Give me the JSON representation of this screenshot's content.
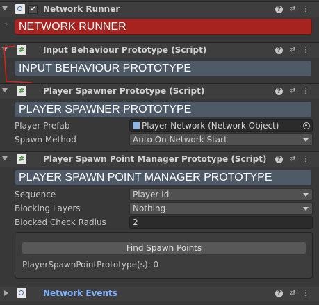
{
  "network_runner": {
    "title": "Network Runner",
    "enabled_check": "✔",
    "banner": "NETWORK RUNNER"
  },
  "input_behaviour": {
    "title": "Input Behaviour Prototype (Script)",
    "banner": "INPUT BEHAVIOUR PROTOTYPE"
  },
  "player_spawner": {
    "title": "Player Spawner Prototype (Script)",
    "banner": "PLAYER SPAWNER PROTOTYPE",
    "player_prefab_label": "Player Prefab",
    "player_prefab_value": "Player Network (Network Object)",
    "spawn_method_label": "Spawn Method",
    "spawn_method_value": "Auto On Network Start"
  },
  "spawn_point_manager": {
    "title": "Player Spawn Point Manager Prototype (Script)",
    "banner": "PLAYER SPAWN POINT MANAGER PROTOTYPE",
    "sequence_label": "Sequence",
    "sequence_value": "Player Id",
    "blocking_layers_label": "Blocking Layers",
    "blocking_layers_value": "Nothing",
    "blocked_radius_label": "Blocked Check Radius",
    "blocked_radius_value": "2",
    "find_button": "Find Spawn Points",
    "count_text": "PlayerSpawnPointPrototype(s): 0"
  },
  "network_events": {
    "title": "Network Events"
  },
  "header_buttons": {
    "help": "?",
    "presets": "⇄",
    "menu": "⋮"
  },
  "icons": {
    "doc": "network-runner-icon",
    "script": "script-hash-icon",
    "hash_glyph": "#"
  },
  "colors": {
    "red_banner": "#a7231f",
    "blue_banner": "#4e5a67",
    "link_title": "#7fb1ff"
  }
}
